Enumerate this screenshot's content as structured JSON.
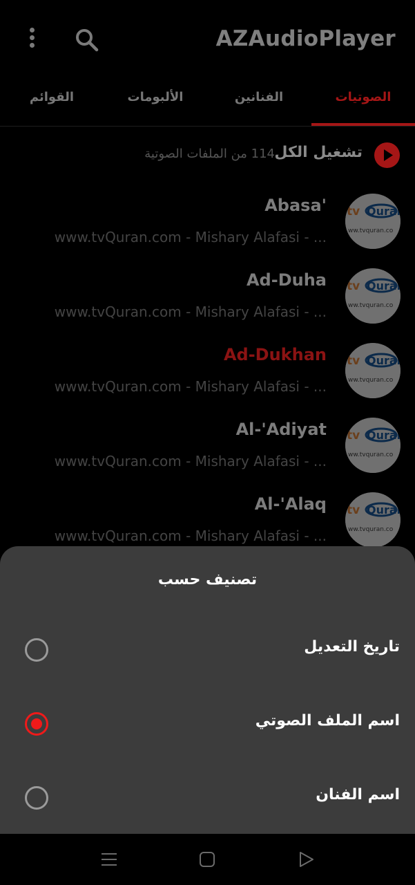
{
  "app": {
    "title": "AZAudioPlayer"
  },
  "tabs": [
    {
      "label": "الصوتيات",
      "active": true
    },
    {
      "label": "الفنانين",
      "active": false
    },
    {
      "label": "الألبومات",
      "active": false
    },
    {
      "label": "القوائم",
      "active": false
    }
  ],
  "play_all": {
    "label": "تشغيل الكل",
    "count": "114 من الملفات الصوتية"
  },
  "songs": [
    {
      "title": "Abasa'",
      "subtitle": "www.tvQuran.com - Mishary Alafasi - ...",
      "playing": false
    },
    {
      "title": "Ad-Duha",
      "subtitle": "www.tvQuran.com - Mishary Alafasi - ...",
      "playing": false
    },
    {
      "title": "Ad-Dukhan",
      "subtitle": "www.tvQuran.com - Mishary Alafasi - ...",
      "playing": true
    },
    {
      "title": "Al-'Adiyat",
      "subtitle": "www.tvQuran.com - Mishary Alafasi - ...",
      "playing": false
    },
    {
      "title": "Al-'Alaq",
      "subtitle": "www.tvQuran.com - Mishary Alafasi - ...",
      "playing": false
    }
  ],
  "sort_sheet": {
    "title": "تصنيف حسب",
    "options": [
      {
        "label": "تاريخ التعديل",
        "selected": false
      },
      {
        "label": "اسم الملف الصوتي",
        "selected": true
      },
      {
        "label": "اسم الفنان",
        "selected": false
      }
    ]
  },
  "colors": {
    "accent": "#a51616",
    "radio_selected": "#ef1a1a",
    "sheet_bg": "#3c3c3c"
  },
  "icons": [
    "more-vert-icon",
    "search-icon",
    "play-circle-icon",
    "tvquran-thumbnail",
    "menu-nav-icon",
    "home-nav-icon",
    "back-nav-icon"
  ]
}
